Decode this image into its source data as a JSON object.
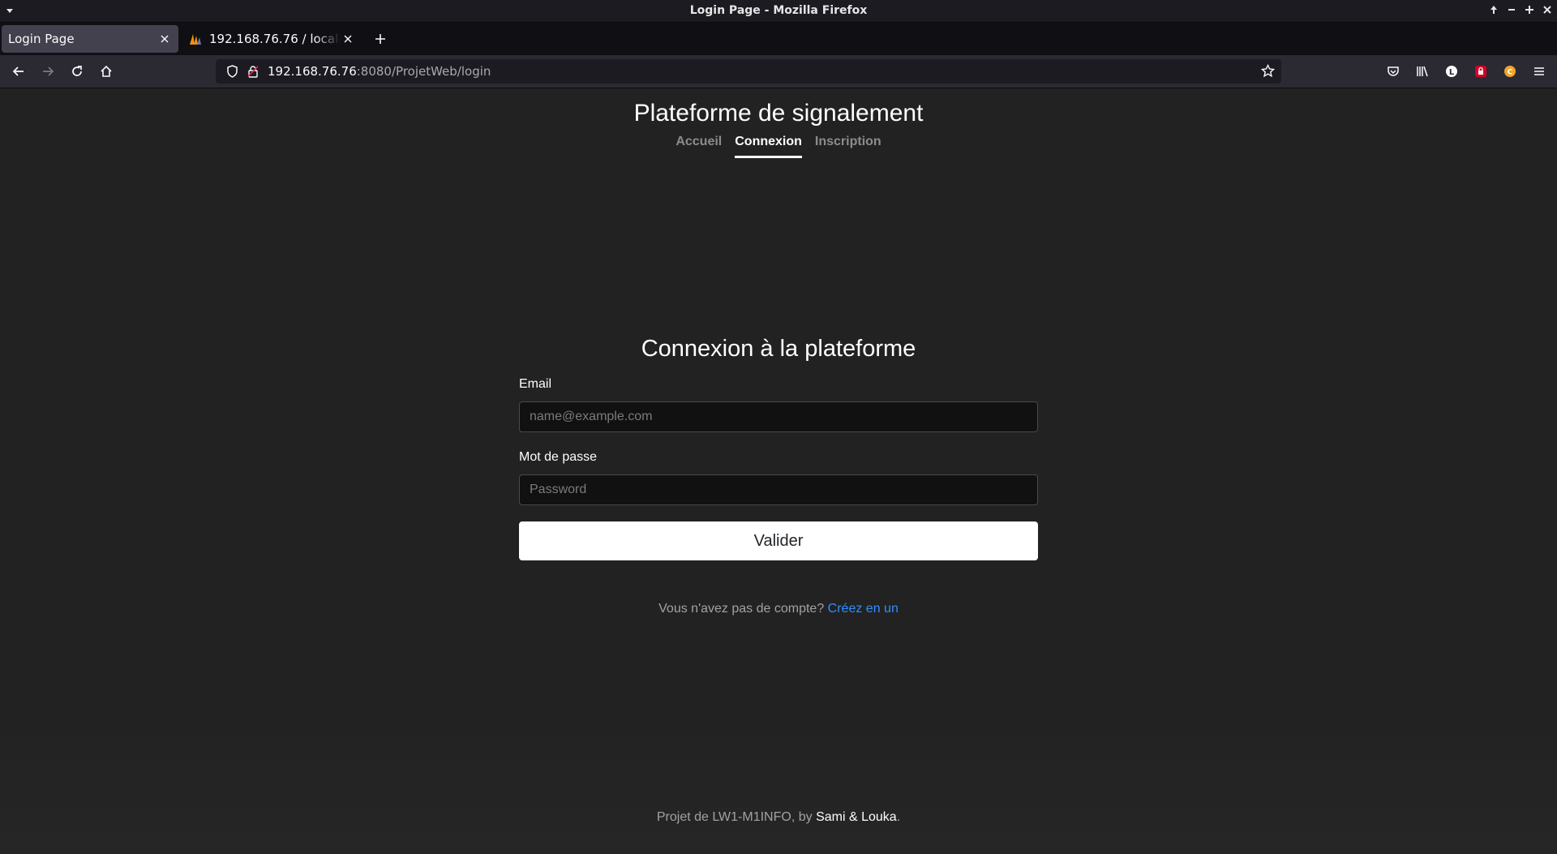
{
  "window": {
    "title": "Login Page - Mozilla Firefox"
  },
  "tabs": [
    {
      "label": "Login Page",
      "active": true
    },
    {
      "label": "192.168.76.76 / localhost",
      "active": false
    }
  ],
  "urlbar": {
    "host": "192.168.76.76",
    "rest": ":8080/ProjetWeb/login"
  },
  "site": {
    "title": "Plateforme de signalement",
    "nav": [
      {
        "label": "Accueil",
        "active": false
      },
      {
        "label": "Connexion",
        "active": true
      },
      {
        "label": "Inscription",
        "active": false
      }
    ]
  },
  "login_form": {
    "heading": "Connexion à la plateforme",
    "email_label": "Email",
    "email_placeholder": "name@example.com",
    "password_label": "Mot de passe",
    "password_placeholder": "Password",
    "submit_label": "Valider",
    "signup_prompt": "Vous n'avez pas de compte?",
    "signup_link": "Créez en un"
  },
  "footer": {
    "prefix": "Projet de LW1-M1INFO, by",
    "authors": "Sami & Louka",
    "suffix": "."
  },
  "icons": {
    "firefox_ext_pocket": "pocket-icon",
    "library": "library-icon",
    "account": "account-icon"
  },
  "colors": {
    "page_bg": "#222222",
    "link": "#2f8fff",
    "button_bg": "#ffffff"
  }
}
